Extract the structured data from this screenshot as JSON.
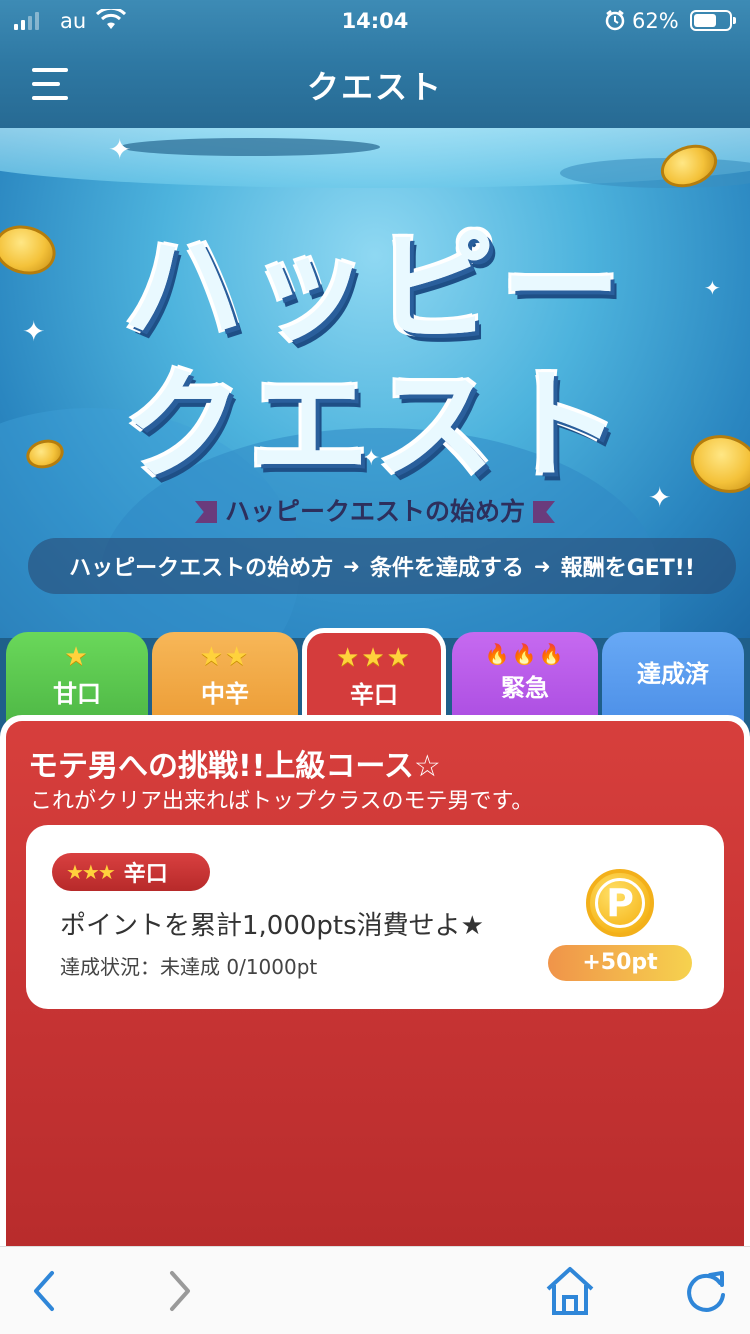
{
  "status_bar": {
    "carrier": "au",
    "time": "14:04",
    "battery": "62%"
  },
  "header": {
    "title": "クエスト",
    "menu_icon": "hamburger-menu-icon"
  },
  "banner": {
    "title_line1": "ハッピー",
    "title_line2": "クエスト",
    "how_to_label": "ハッピークエストの始め方",
    "steps": [
      "ハッピークエストの始め方",
      "条件を達成する",
      "報酬をGET!!"
    ]
  },
  "tabs": [
    {
      "label": "甘口",
      "stars": "★",
      "color": "#5cc84e"
    },
    {
      "label": "中辛",
      "stars": "★★",
      "color": "#f0a843"
    },
    {
      "label": "辛口",
      "stars": "★★★",
      "color": "#d43c3c",
      "selected": true
    },
    {
      "label": "緊急",
      "stars": "🔥🔥🔥",
      "color": "#b85ae8"
    },
    {
      "label": "達成済",
      "stars": "",
      "color": "#5a9bef"
    }
  ],
  "mission": {
    "title": "モテ男への挑戦!!上級コース☆",
    "subtitle": "これがクリア出来ればトップクラスのモテ男です。"
  },
  "quest": {
    "badge_stars": "★★★",
    "badge_label": "辛口",
    "text": "ポイントを累計1,000pts消費せよ★",
    "status": "達成状況：未達成 0/1000pt",
    "coin_letter": "P",
    "reward": "+50pt"
  },
  "toolbar": {
    "back": "back-icon",
    "forward": "forward-icon",
    "home": "home-icon",
    "reload": "reload-icon"
  }
}
